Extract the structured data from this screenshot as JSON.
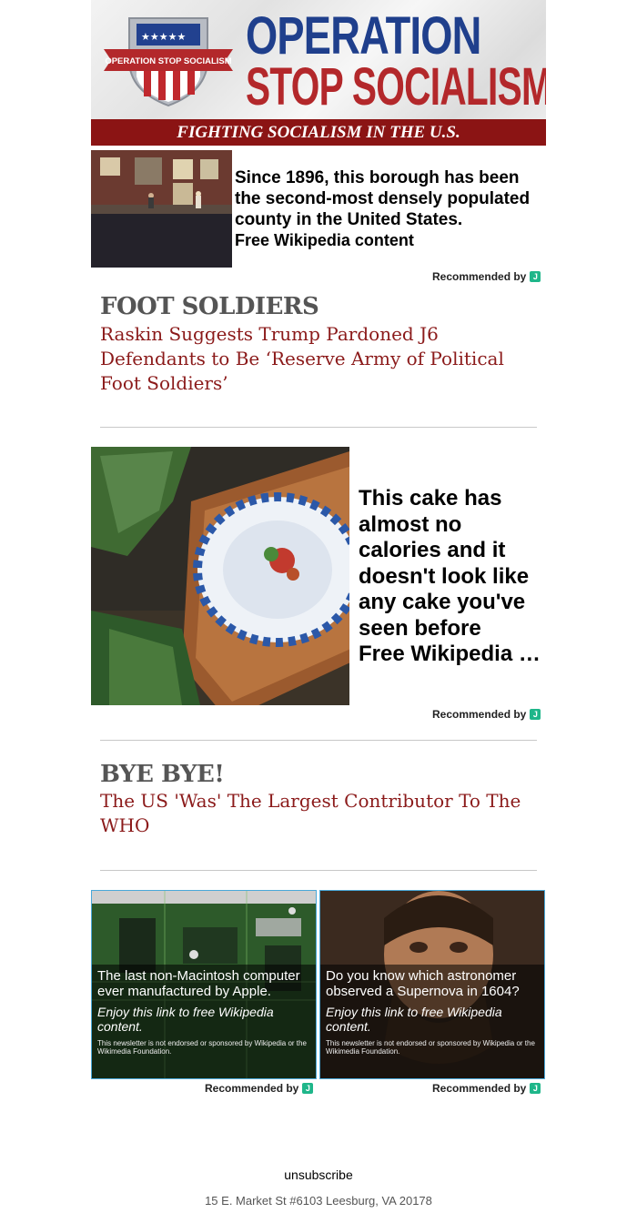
{
  "header": {
    "shield_text": "OPERATION STOP SOCIALISM",
    "title_line1": "OPERATION",
    "title_line2": "STOP SOCIALISM",
    "tagline": "FIGHTING SOCIALISM IN THE U.S."
  },
  "ad1": {
    "text": "Since 1896, this borough has been the second-most densely populated county in the United States.",
    "source": "Free Wikipedia content",
    "recommended": "Recommended by",
    "badge": "J"
  },
  "article1": {
    "kicker": "FOOT SOLDIERS",
    "headline": "Raskin Suggests Trump Pardoned J6 Defendants to Be ‘Reserve Army of Political Foot Soldiers’"
  },
  "ad2": {
    "text": "This cake has almost no calories and it doesn't look like any cake you've seen before",
    "source": "Free Wikipedia content",
    "recommended": "Recommended by",
    "badge": "J"
  },
  "article2": {
    "kicker": "BYE BYE!",
    "headline": "The US 'Was' The Largest Contributor To The WHO"
  },
  "cards": [
    {
      "title": "The last non-Macintosh computer ever manufactured by Apple.",
      "sub": "Enjoy this link to free Wikipedia content.",
      "note": "This newsletter is not endorsed or sponsored by Wikipedia or the Wikimedia Foundation.",
      "recommended": "Recommended by",
      "badge": "J"
    },
    {
      "title": "Do you know which astronomer observed a Supernova in 1604?",
      "sub": "Enjoy this link to free Wikipedia content.",
      "note": "This newsletter is not endorsed or sponsored by Wikipedia or the Wikimedia Foundation.",
      "recommended": "Recommended by",
      "badge": "J"
    }
  ],
  "footer": {
    "unsubscribe": "unsubscribe",
    "address": "15 E. Market St #6103 Leesburg, VA 20178"
  },
  "colors": {
    "brand_blue": "#1f3f8c",
    "brand_red": "#b3282b",
    "tagline_bg": "#8b1414",
    "headline_red": "#8b1a1a",
    "badge_green": "#1fb68a"
  }
}
